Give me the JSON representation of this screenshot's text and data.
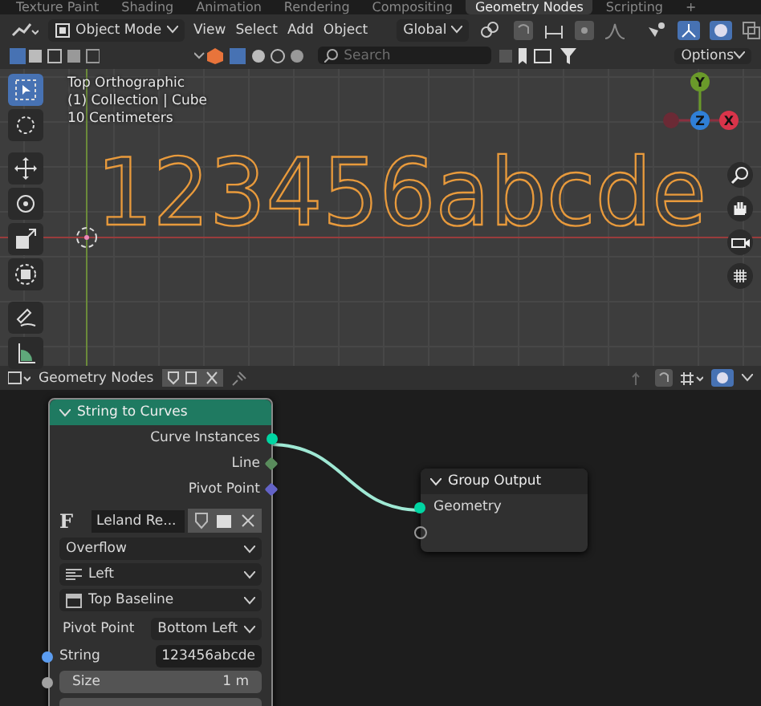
{
  "workspace_tabs": [
    {
      "label": "Texture Paint",
      "selected": false
    },
    {
      "label": "Shading",
      "selected": false
    },
    {
      "label": "Animation",
      "selected": false
    },
    {
      "label": "Rendering",
      "selected": false
    },
    {
      "label": "Compositing",
      "selected": false
    },
    {
      "label": "Geometry Nodes",
      "selected": true
    },
    {
      "label": "Scripting",
      "selected": false
    }
  ],
  "add_tab": "+",
  "viewport_header": {
    "mode": "Object Mode",
    "menus": [
      "View",
      "Select",
      "Add",
      "Object"
    ],
    "orientation": "Global"
  },
  "search": {
    "placeholder": "Search"
  },
  "options": "Options",
  "viewport": {
    "overlay_lines": [
      "Top Orthographic",
      "(1) Collection | Cube",
      "10 Centimeters"
    ],
    "object_text": "123456abcde",
    "axes": [
      {
        "label": "Y",
        "color": "#6a9a2a"
      },
      {
        "label": "Z",
        "color": "#2f7fd6"
      },
      {
        "label": "X",
        "color": "#d9344a"
      }
    ]
  },
  "node_editor": {
    "tree_name": "Geometry Nodes"
  },
  "string_to_curves": {
    "title": "String to Curves",
    "rows": [
      {
        "kind": "output",
        "label": "Curve Instances",
        "color": "#00d6a3"
      },
      {
        "kind": "output",
        "label": "Line",
        "color": "#598c5c"
      },
      {
        "kind": "output",
        "label": "Pivot Point",
        "color": "#6363c7"
      },
      {
        "kind": "font",
        "icon": "F",
        "value": "Leland Re..."
      },
      {
        "kind": "dropdown",
        "value": "Overflow"
      },
      {
        "kind": "dropdown",
        "value": "Left"
      },
      {
        "kind": "dropdown",
        "value": "Top Baseline"
      },
      {
        "kind": "labeled",
        "label": "Pivot Point",
        "value": "Bottom Left"
      },
      {
        "kind": "text",
        "label": "String",
        "value": "123456abcde",
        "color": "#5b9cf0"
      },
      {
        "kind": "number",
        "label": "Size",
        "value": "1 m",
        "color": "#a1a1a1"
      }
    ]
  },
  "group_output": {
    "title": "Group Output",
    "inputs": [
      {
        "label": "Geometry",
        "color": "#00d6a3"
      }
    ]
  }
}
